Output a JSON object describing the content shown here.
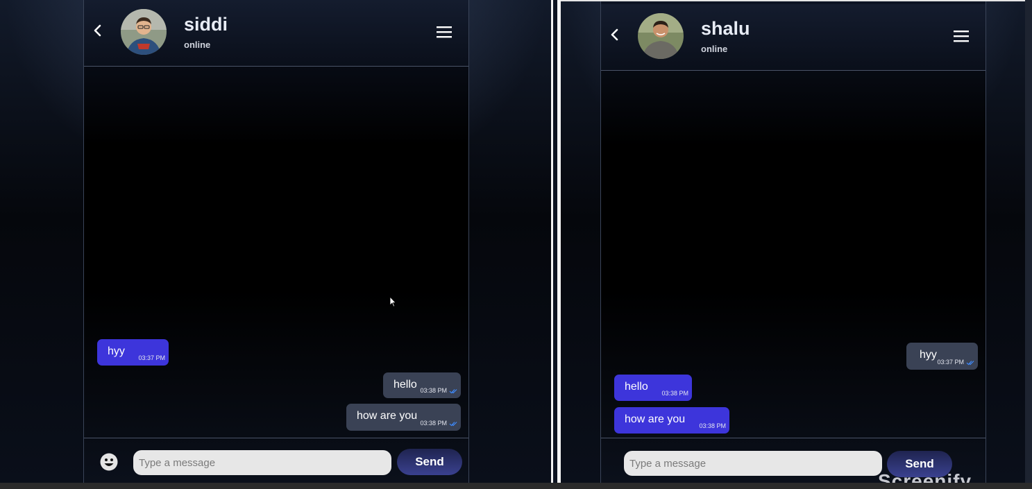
{
  "colors": {
    "received_bubble": "#3d35db",
    "sent_bubble": "#3a4255",
    "read_tick": "#3f8cff",
    "send_button": "#2e3475"
  },
  "icons": [
    "back-arrow-icon",
    "hamburger-menu-icon",
    "emoji-icon",
    "double-check-icon",
    "mouse-cursor-icon"
  ],
  "left_window": {
    "contact_name": "siddi",
    "contact_status": "online",
    "messages": [
      {
        "text": "hyy",
        "time": "03:37 PM",
        "direction": "received"
      },
      {
        "text": "hello",
        "time": "03:38 PM",
        "direction": "sent"
      },
      {
        "text": "how are you",
        "time": "03:38 PM",
        "direction": "sent"
      }
    ],
    "input_placeholder": "Type a message",
    "send_label": "Send"
  },
  "right_window": {
    "contact_name": "shalu",
    "contact_status": "online",
    "messages": [
      {
        "text": "hyy",
        "time": "03:37 PM",
        "direction": "sent"
      },
      {
        "text": "hello",
        "time": "03:38 PM",
        "direction": "received"
      },
      {
        "text": "how are you",
        "time": "03:38 PM",
        "direction": "received"
      }
    ],
    "input_placeholder": "Type a message",
    "send_label": "Send"
  },
  "watermark_text": "Screenify"
}
